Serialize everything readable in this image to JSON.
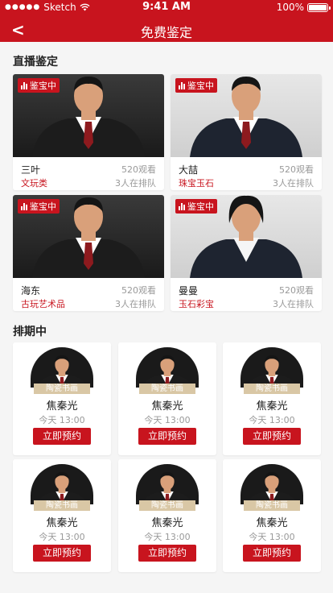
{
  "status_bar": {
    "carrier": "Sketch",
    "time": "9:41 AM",
    "battery": "100%"
  },
  "nav": {
    "back_icon": "chevron-left-icon",
    "title": "免费鉴定"
  },
  "live_section": {
    "title": "直播鉴定",
    "badge": "鉴宝中",
    "items": [
      {
        "name": "三叶",
        "views": "520观看",
        "category": "文玩类",
        "queue": "3人在排队",
        "bg": "dark",
        "gender": "m"
      },
      {
        "name": "大喆",
        "views": "520观看",
        "category": "珠宝玉石",
        "queue": "3人在排队",
        "bg": "light",
        "gender": "m"
      },
      {
        "name": "海东",
        "views": "520观看",
        "category": "古玩艺术品",
        "queue": "3人在排队",
        "bg": "dark",
        "gender": "m"
      },
      {
        "name": "曼曼",
        "views": "520观看",
        "category": "玉石彩宝",
        "queue": "3人在排队",
        "bg": "light",
        "gender": "f"
      }
    ]
  },
  "schedule_section": {
    "title": "排期中",
    "items": [
      {
        "tag": "陶瓷书画",
        "name": "焦秦光",
        "time": "今天 13:00",
        "button": "立即预约"
      },
      {
        "tag": "陶瓷书画",
        "name": "焦秦光",
        "time": "今天 13:00",
        "button": "立即预约"
      },
      {
        "tag": "陶瓷书画",
        "name": "焦秦光",
        "time": "今天 13:00",
        "button": "立即预约"
      },
      {
        "tag": "陶瓷书画",
        "name": "焦秦光",
        "time": "今天 13:00",
        "button": "立即预约"
      },
      {
        "tag": "陶瓷书画",
        "name": "焦秦光",
        "time": "今天 13:00",
        "button": "立即预约"
      },
      {
        "tag": "陶瓷书画",
        "name": "焦秦光",
        "time": "今天 13:00",
        "button": "立即预约"
      }
    ]
  },
  "colors": {
    "brand": "#c8141e",
    "tag": "#d9c7a5"
  }
}
